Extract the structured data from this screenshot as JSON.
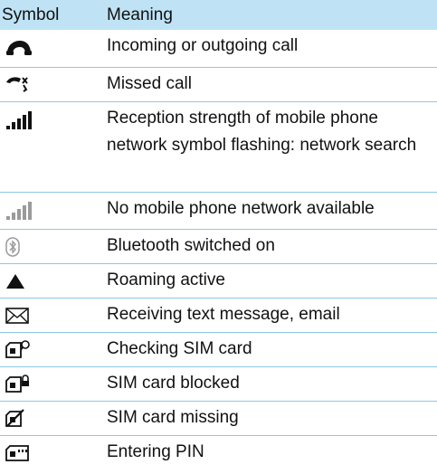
{
  "header": {
    "symbol": "Symbol",
    "meaning": "Meaning"
  },
  "rows": [
    {
      "icon": "phone-handset-icon",
      "meaning": "Incoming or outgoing call"
    },
    {
      "icon": "missed-call-icon",
      "meaning": "Missed call"
    },
    {
      "icon": "signal-bars-icon",
      "meaning": "Reception strength of mobile phone network symbol flashing: network search"
    },
    {
      "icon": "signal-bars-grey-icon",
      "meaning": "No mobile phone network available"
    },
    {
      "icon": "bluetooth-icon",
      "meaning": "Bluetooth switched on"
    },
    {
      "icon": "roaming-triangle-icon",
      "meaning": "Roaming active"
    },
    {
      "icon": "envelope-icon",
      "meaning": "Receiving text message, email"
    },
    {
      "icon": "sim-checking-icon",
      "meaning": "Checking SIM card"
    },
    {
      "icon": "sim-blocked-icon",
      "meaning": "SIM card blocked"
    },
    {
      "icon": "sim-missing-icon",
      "meaning": "SIM card missing"
    },
    {
      "icon": "sim-pin-icon",
      "meaning": "Entering PIN"
    }
  ],
  "colors": {
    "header_bg": "#bfe3f5",
    "row_divider": "#8fc8e6",
    "grey_icon": "#9a9a9a"
  }
}
